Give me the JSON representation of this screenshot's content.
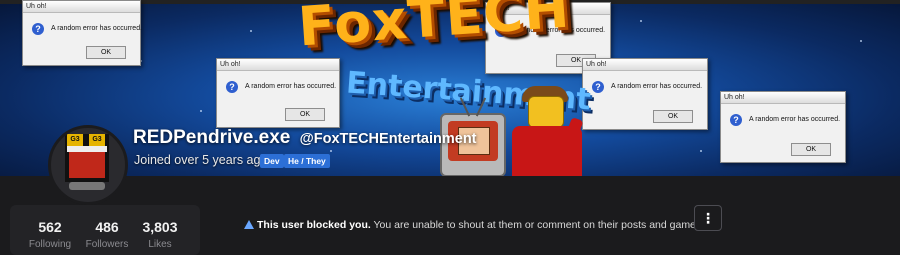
{
  "banner": {
    "title_line1": "FoxTECH",
    "title_line2": "Entertainment",
    "dialog_title": "Uh oh!",
    "dialog_message": "A random error has occurred.",
    "dialog_ok": "OK",
    "tv_badge": "G3"
  },
  "profile": {
    "username": "REDPendrive.exe",
    "handle": "@FoxTECHEntertainment",
    "joined": "Joined over 5 years ago",
    "tags": [
      "Dev",
      "He / They"
    ]
  },
  "stats": [
    {
      "value": "562",
      "label": "Following"
    },
    {
      "value": "486",
      "label": "Followers"
    },
    {
      "value": "3,803",
      "label": "Likes"
    }
  ],
  "notice": {
    "bold": "This user blocked you.",
    "text": " You are unable to shout at them or comment on their posts and games."
  },
  "more_button": "⋮",
  "colors": {
    "background": "#1b1b1d",
    "tag": "#2c6fd6",
    "banner": "#134a9c"
  }
}
